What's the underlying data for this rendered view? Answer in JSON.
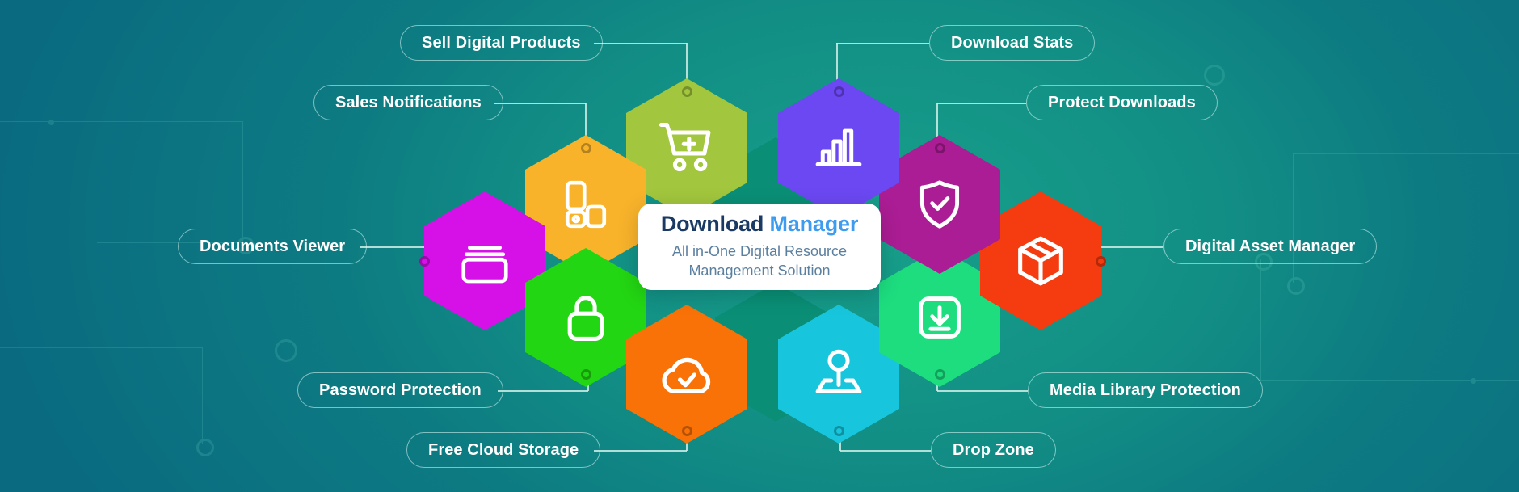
{
  "theme": {
    "bg_teal_dark": "#0a5f7c",
    "bg_teal_mid": "#0f8d86",
    "bg_teal_light": "#17a08a",
    "pill_text": "#ffffff",
    "pill_border": "rgba(225,250,245,0.55)",
    "connector": "#cfeee7",
    "card_bg": "#ffffff",
    "title_dark": "#1b3a63",
    "title_blue": "#3d9bf0",
    "subtitle": "#5b7f9e"
  },
  "center_card": {
    "title_part1": "Download",
    "title_part2": "Manager",
    "subtitle_line1": "All in-One Digital Resource",
    "subtitle_line2": "Management Solution"
  },
  "features": [
    {
      "id": "sell-digital-products",
      "label": "Sell Digital Products",
      "icon": "shopping-cart-plus-icon",
      "color": "#a2c63d"
    },
    {
      "id": "sales-notifications",
      "label": "Sales Notifications",
      "icon": "blocks-layout-icon",
      "color": "#f8b32b"
    },
    {
      "id": "documents-viewer",
      "label": "Documents Viewer",
      "icon": "documents-window-icon",
      "color": "#d511e8"
    },
    {
      "id": "password-protection",
      "label": "Password Protection",
      "icon": "padlock-icon",
      "color": "#23d613"
    },
    {
      "id": "free-cloud-storage",
      "label": "Free Cloud Storage",
      "icon": "cloud-check-icon",
      "color": "#f97207"
    },
    {
      "id": "drop-zone",
      "label": "Drop Zone",
      "icon": "drop-pin-icon",
      "color": "#17c6dd"
    },
    {
      "id": "media-library-protection",
      "label": "Media Library Protection",
      "icon": "download-box-icon",
      "color": "#1ddd7f"
    },
    {
      "id": "digital-asset-manager",
      "label": "Digital Asset Manager",
      "icon": "package-box-icon",
      "color": "#f53b10"
    },
    {
      "id": "protect-downloads",
      "label": "Protect Downloads",
      "icon": "shield-check-icon",
      "color": "#ab1d94"
    },
    {
      "id": "download-stats",
      "label": "Download Stats",
      "icon": "bar-chart-icon",
      "color": "#6b48f2"
    }
  ]
}
